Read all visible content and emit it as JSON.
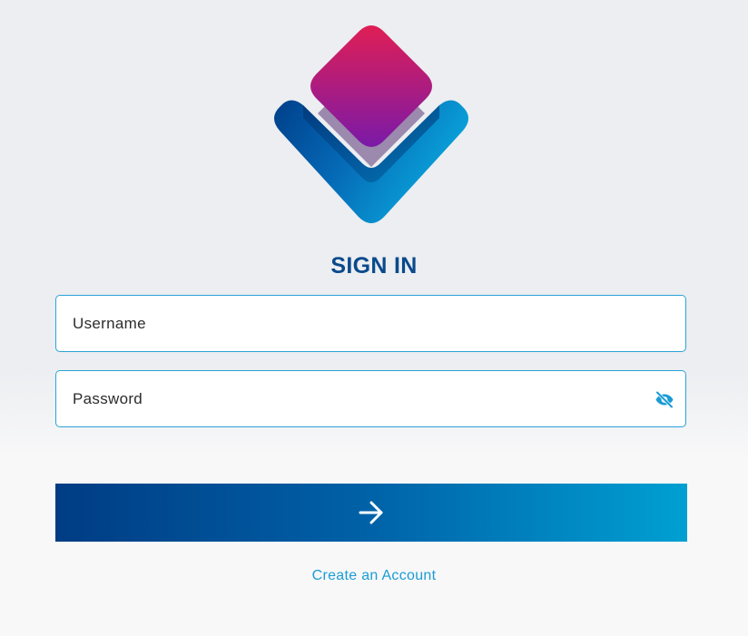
{
  "header": {
    "title": "SIGN IN"
  },
  "logo": {
    "icon": "diamond-chevron-logo",
    "colors": {
      "diamond_top": "#e01e55",
      "diamond_bottom": "#7a1aa8",
      "chevron_dark": "#003f8a",
      "chevron_light": "#0aa0d8"
    }
  },
  "form": {
    "username": {
      "placeholder": "Username",
      "value": ""
    },
    "password": {
      "placeholder": "Password",
      "value": "",
      "toggle_icon": "eye-off-icon"
    },
    "submit": {
      "icon": "arrow-right-icon",
      "gradient_start": "#003c84",
      "gradient_end": "#00a0d2"
    },
    "create_account_label": "Create an Account"
  },
  "colors": {
    "accent": "#1a9cd4",
    "title": "#0a4a8c",
    "field_border": "#2aa3d8",
    "background": "#eceef1"
  }
}
